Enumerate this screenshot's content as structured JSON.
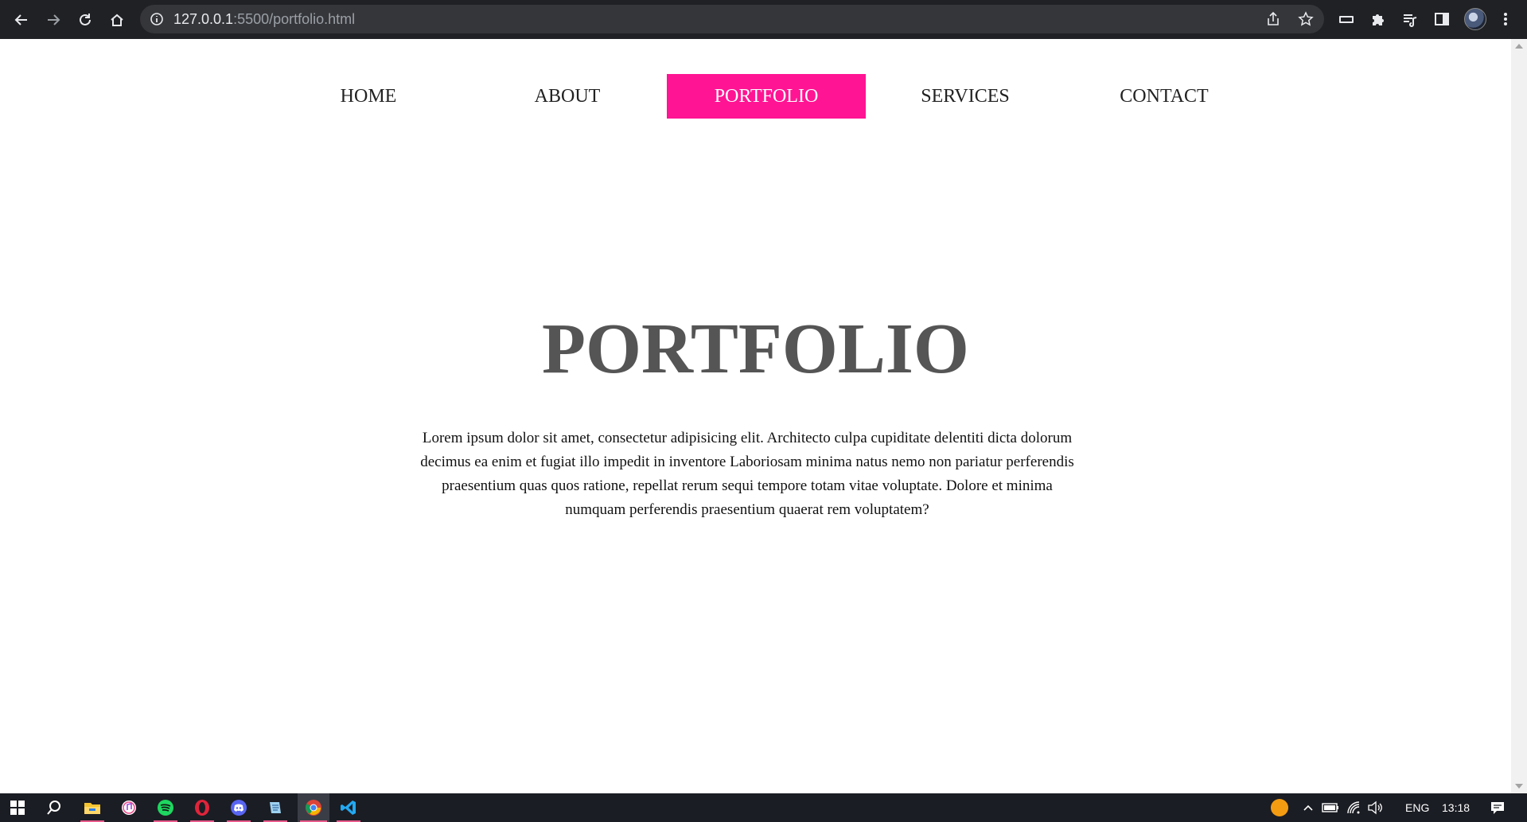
{
  "browser": {
    "url_host": "127.0.0.1",
    "url_path": ":5500/portfolio.html",
    "icons": [
      "back-icon",
      "forward-icon",
      "reload-icon",
      "home-icon",
      "info-icon",
      "share-icon",
      "bookmark-star-icon",
      "media-icon",
      "extensions-icon",
      "reading-list-icon",
      "side-panel-icon",
      "profile-avatar",
      "menu-dots-icon"
    ]
  },
  "nav": {
    "items": [
      {
        "label": "HOME"
      },
      {
        "label": "ABOUT"
      },
      {
        "label": "PORTFOLIO",
        "active": true
      },
      {
        "label": "SERVICES"
      },
      {
        "label": "CONTACT"
      }
    ],
    "active_color": "#ff1493"
  },
  "main": {
    "title": "PORTFOLIO",
    "text": "Lorem ipsum dolor sit amet, consectetur adipisicing elit. Architecto culpa cupiditate delentiti dicta dolorum decimus ea enim et fugiat illo impedit in inventore Laboriosam minima natus nemo non pariatur perferendis praesentium quas quos ratione, repellat rerum sequi tempore totam vitae voluptate. Dolore et minima numquam perferendis praesentium quaerat rem voluptatem?"
  },
  "taskbar": {
    "apps": [
      "start-icon",
      "search-icon",
      "file-explorer-icon",
      "itunes-icon",
      "spotify-icon",
      "opera-icon",
      "discord-icon",
      "notepad-icon",
      "chrome-icon",
      "vscode-icon"
    ],
    "language": "ENG",
    "time": "13:18"
  }
}
